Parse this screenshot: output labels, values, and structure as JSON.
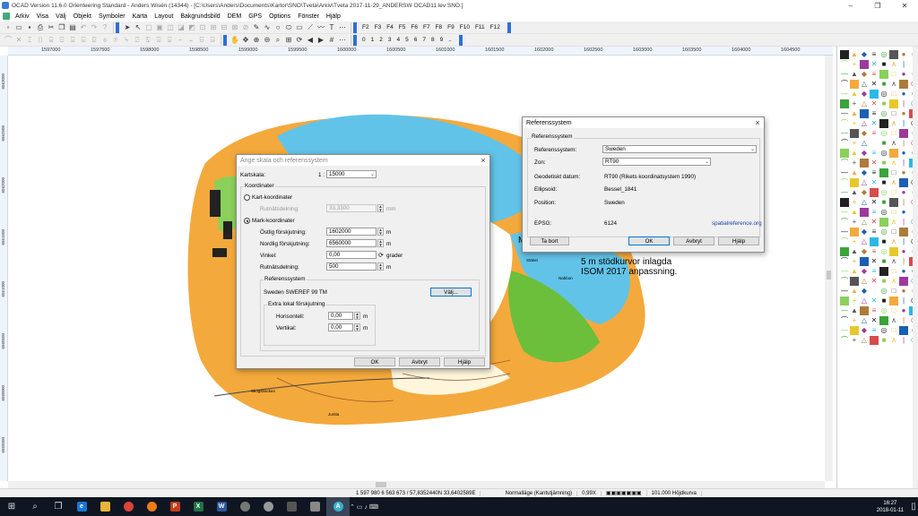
{
  "window": {
    "title": "OCAD Version 11.6.0 Orienteering Standard - Anders Wisén (14344) - [C:\\Users\\Anders\\Documents\\Kartor\\SNO\\Tveta\\Arkiv\\Tveta 2017-11-29_ANDERSW OCAD11 lev SNO.]",
    "min": "–",
    "max": "❐",
    "close": "✕"
  },
  "menu": [
    "Arkiv",
    "Visa",
    "Välj",
    "Objekt",
    "Symboler",
    "Karta",
    "Layout",
    "Bakgrundsbild",
    "DEM",
    "GPS",
    "Options",
    "Fönster",
    "Hjälp"
  ],
  "toolbar": {
    "fkeys": [
      "F2",
      "F3",
      "F4",
      "F5",
      "F6",
      "F7",
      "F8",
      "F9",
      "F10",
      "F11",
      "F12"
    ],
    "digits": [
      "0",
      "1",
      "2",
      "3",
      "4",
      "5",
      "6",
      "7",
      "8",
      "9",
      ".."
    ]
  },
  "ruler": {
    "x": [
      "1597000",
      "1597500",
      "1598000",
      "1598500",
      "1599000",
      "1599500",
      "1600000",
      "1600500",
      "1601000",
      "1601500",
      "1602000",
      "1602500",
      "1603000",
      "1603500",
      "1604000",
      "1604500"
    ],
    "y": [
      "6563000",
      "6562500",
      "6562000",
      "6561500",
      "6561000",
      "6560500",
      "6560000",
      "6559500"
    ]
  },
  "map_text": {
    "line1": "5 m stödkurvor inlagda",
    "line2": "ISOM 2017 anpassning.",
    "partial": "M",
    "places": [
      "Stäket",
      "Nabbon",
      "Skogsbacken",
      "Jursta"
    ]
  },
  "dialog_scale": {
    "title": "Ange skala och referenssystem",
    "kartskala_label": "Kartskala:",
    "kartskala_prefix": "1 :",
    "kartskala_value": "15000",
    "koordinater_group": "Koordinater",
    "kart_koord": "Kart-koordinater",
    "rutnat_label_dis": "Rutnätsdelning:",
    "rutnat_value_dis": "33,3300",
    "rutnat_unit_dis": "mm",
    "mark_koord": "Mark-koordinater",
    "ostlig_label": "Östlig förskjutning:",
    "ostlig_value": "1602000",
    "nordlig_label": "Nordlig förskjutning:",
    "nordlig_value": "6560000",
    "vinkel_label": "Vinkel:",
    "vinkel_value": "0,00",
    "vinkel_unit": "grader",
    "rutnat_label": "Rutnätsdelning:",
    "rutnat_value": "500",
    "unit_m": "m",
    "refsys_group": "Referenssystem",
    "refsys_value": "Sweden  SWEREF 99 TM",
    "valj": "Välj...",
    "extra_group": "Extra lokal förskjutning",
    "horisontell_label": "Horisontell:",
    "horisontell_value": "0,00",
    "vertikal_label": "Vertikal:",
    "vertikal_value": "0,00",
    "ok": "OK",
    "avbryt": "Avbryt",
    "hjalp": "Hjälp"
  },
  "dialog_ref": {
    "title": "Referenssystem",
    "group": "Referenssystem",
    "refsys_label": "Referenssystem:",
    "refsys_value": "Sweden",
    "zon_label": "Zon:",
    "zon_value": "RT90",
    "datum_label": "Geodetiskt datum:",
    "datum_value": "RT90 (Rikets koordinatsystem 1990)",
    "ellips_label": "Ellipsoid:",
    "ellips_value": "Bessel_1841",
    "position_label": "Position:",
    "position_value": "Sweden",
    "epsg_label": "EPSG:",
    "epsg_value": "6124",
    "link": "spatialreference.org",
    "ta_bort": "Ta bort",
    "ok": "OK",
    "avbryt": "Avbryt",
    "hjalp": "Hjälp"
  },
  "status": [
    "1 597 980  6 563 673  /  57,8352440N  33,6402589E",
    "Normalläge (Kantutjämning)",
    "0,99X",
    "101.000 Höjdkurva"
  ],
  "taskbar": {
    "time": "16:27",
    "date": "2018-01-11"
  }
}
